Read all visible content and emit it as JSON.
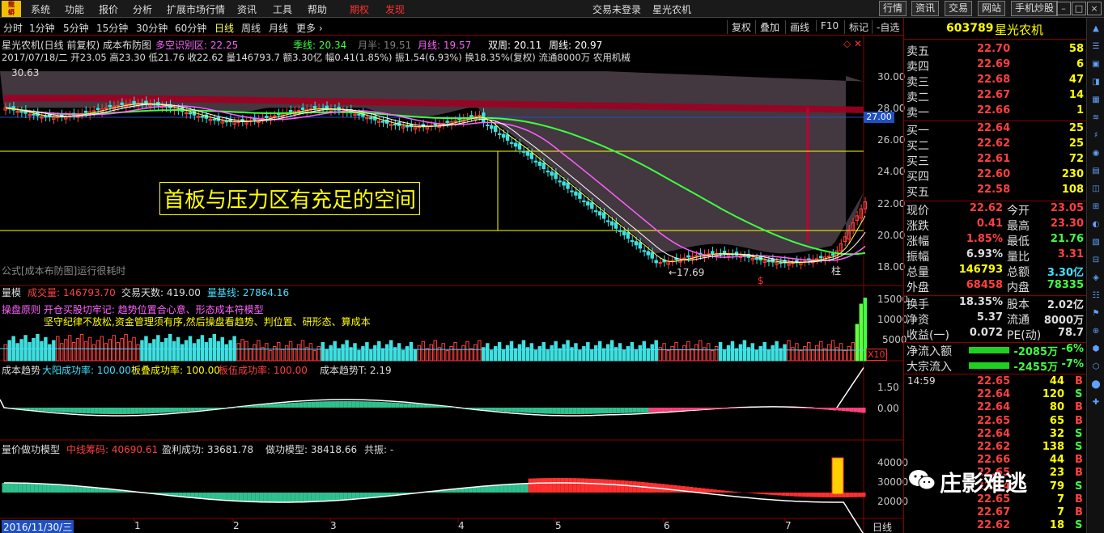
{
  "menubar": {
    "items": [
      "系统",
      "功能",
      "报价",
      "分析",
      "扩展市场行情",
      "资讯",
      "工具",
      "帮助"
    ],
    "highlight_items": [
      "期权",
      "发现"
    ],
    "status": "交易未登录",
    "stock_title": "星光农机",
    "buttons": [
      "行情",
      "资讯",
      "交易",
      "网站",
      "手机炒股"
    ]
  },
  "periods": [
    "分时",
    "1分钟",
    "5分钟",
    "15分钟",
    "30分钟",
    "60分钟",
    "日线",
    "周线",
    "月线",
    "更多 ›"
  ],
  "active_period": "日线",
  "tools": [
    "复权",
    "叠加",
    "画线",
    "F10",
    "标记",
    "-自选"
  ],
  "chart": {
    "title": "星光农机(日线 前复权) 成本布防图",
    "ma_items": [
      {
        "label": "多空识别区: 22.25",
        "color": "#ff60ff"
      },
      {
        "label": "季线: 20.34",
        "color": "#40ff40"
      },
      {
        "label": "月半: 19.51",
        "color": "#808080"
      },
      {
        "label": "月线: 19.57",
        "color": "#ff60ff"
      },
      {
        "label": "双周: 20.11",
        "color": "#ffffff"
      },
      {
        "label": "周线: 20.97",
        "color": "#ffffff"
      }
    ],
    "ohlc_line": "2017/07/18/二 开23.05 高23.30 低21.76 收22.62 量146793.7 额3.30亿 幅0.41(1.85%) 振1.54(6.93%) 换18.35%(复权) 流通8000万 农用机械",
    "annotation": "首板与压力区有充足的空间",
    "price_high_label": "30.63",
    "price_low_label": "←17.69",
    "marker_zhu": "柱",
    "marker_s": "$",
    "formula_note": "公式[成本布防图]运行很耗时",
    "cursor_price": "27.00",
    "price_ticks": [
      "30.00",
      "28.00",
      "26.00",
      "24.00",
      "22.00",
      "20.00",
      "18.00"
    ],
    "vol_header": "量模",
    "vol_items": [
      "成交量: 146793.70",
      "交易天数: 419.00",
      "量基线: 27864.16"
    ],
    "vol_note1": "操盘原则  开仓买股切牢记: 趋势位置合心意、形态成本符模型",
    "vol_note2": "坚守纪律不放松,资金管理须有序,然后操盘看趋势、判位置、研形态、算成本",
    "vol_ticks": [
      "15000",
      "10000",
      "5000"
    ],
    "vol_x10": "X10",
    "trend_header": "成本趋势",
    "trend_items": [
      "大阳成功率: 100.00",
      "板叠成功率: 100.00",
      "板伍成功率: 100.00",
      "成本趋势T: 2.19"
    ],
    "trend_ticks": [
      "1.50",
      "0.00"
    ],
    "model_header": "量价做功模型",
    "model_items": [
      "中线筹码: 40690.61",
      "盈利成功: 33681.78",
      "做功模型: 38418.66",
      "共振: -"
    ],
    "model_ticks": [
      "40000",
      "30000",
      "20000"
    ],
    "date_start": "2016/11/30/三",
    "months": [
      "1",
      "2",
      "3",
      "4",
      "5",
      "6",
      "7"
    ],
    "bottom_period": "日线"
  },
  "quote": {
    "code": "603789",
    "name": "星光农机",
    "asks": [
      {
        "label": "卖五",
        "price": "22.70",
        "vol": "58"
      },
      {
        "label": "卖四",
        "price": "22.69",
        "vol": "6"
      },
      {
        "label": "卖三",
        "price": "22.68",
        "vol": "47"
      },
      {
        "label": "卖二",
        "price": "22.67",
        "vol": "14"
      },
      {
        "label": "卖一",
        "price": "22.66",
        "vol": "1"
      }
    ],
    "bids": [
      {
        "label": "买一",
        "price": "22.64",
        "vol": "25"
      },
      {
        "label": "买二",
        "price": "22.62",
        "vol": "25"
      },
      {
        "label": "买三",
        "price": "22.61",
        "vol": "72"
      },
      {
        "label": "买四",
        "price": "22.60",
        "vol": "230"
      },
      {
        "label": "买五",
        "price": "22.58",
        "vol": "108"
      }
    ],
    "stats": [
      {
        "l": "现价",
        "v": "22.62",
        "c": "#ff4040",
        "l2": "今开",
        "v2": "23.05",
        "c2": "#ff4040"
      },
      {
        "l": "涨跌",
        "v": "0.41",
        "c": "#ff4040",
        "l2": "最高",
        "v2": "23.30",
        "c2": "#ff4040"
      },
      {
        "l": "涨幅",
        "v": "1.85%",
        "c": "#ff4040",
        "l2": "最低",
        "v2": "21.76",
        "c2": "#40ff40"
      },
      {
        "l": "振幅",
        "v": "6.93%",
        "c": "#dddddd",
        "l2": "量比",
        "v2": "3.31",
        "c2": "#ff4040"
      },
      {
        "l": "总量",
        "v": "146793",
        "c": "#ffff00",
        "l2": "总额",
        "v2": "3.30亿",
        "c2": "#40e0ff"
      },
      {
        "l": "外盘",
        "v": "68458",
        "c": "#ff4040",
        "l2": "内盘",
        "v2": "78335",
        "c2": "#40ff40"
      }
    ],
    "stats2": [
      {
        "l": "换手",
        "v": "18.35%",
        "l2": "股本",
        "v2": "2.02亿"
      },
      {
        "l": "净资",
        "v": "5.37",
        "l2": "流通",
        "v2": "8000万"
      },
      {
        "l": "收益(一)",
        "v": "0.072",
        "l2": "PE(动)",
        "v2": "78.7"
      }
    ],
    "flows": [
      {
        "l": "净流入额",
        "v": "-2085万",
        "p": "-6%"
      },
      {
        "l": "大宗流入",
        "v": "-2455万",
        "p": "-7%"
      }
    ],
    "ticks": [
      {
        "t": "14:59",
        "p": "22.65",
        "v": "44",
        "d": "B"
      },
      {
        "t": "",
        "p": "22.64",
        "v": "120",
        "d": "S"
      },
      {
        "t": "",
        "p": "22.64",
        "v": "80",
        "d": "B"
      },
      {
        "t": "",
        "p": "22.65",
        "v": "65",
        "d": "B"
      },
      {
        "t": "",
        "p": "22.64",
        "v": "32",
        "d": "S"
      },
      {
        "t": "",
        "p": "22.62",
        "v": "138",
        "d": "S"
      },
      {
        "t": "",
        "p": "22.66",
        "v": "44",
        "d": "B"
      },
      {
        "t": "",
        "p": "22.65",
        "v": "23",
        "d": "B"
      },
      {
        "t": "",
        "p": "22.64",
        "v": "79",
        "d": "S"
      },
      {
        "t": "",
        "p": "22.65",
        "v": "7",
        "d": "B"
      },
      {
        "t": "",
        "p": "22.67",
        "v": "7",
        "d": "B"
      },
      {
        "t": "",
        "p": "22.62",
        "v": "18",
        "d": "S"
      }
    ]
  },
  "watermark": "庄影难逃",
  "colors": {
    "up": "#ff4040",
    "down": "#40e0e0",
    "ma_season": "#40ff40",
    "grid": "#8b0000",
    "label": "#ffff00"
  }
}
